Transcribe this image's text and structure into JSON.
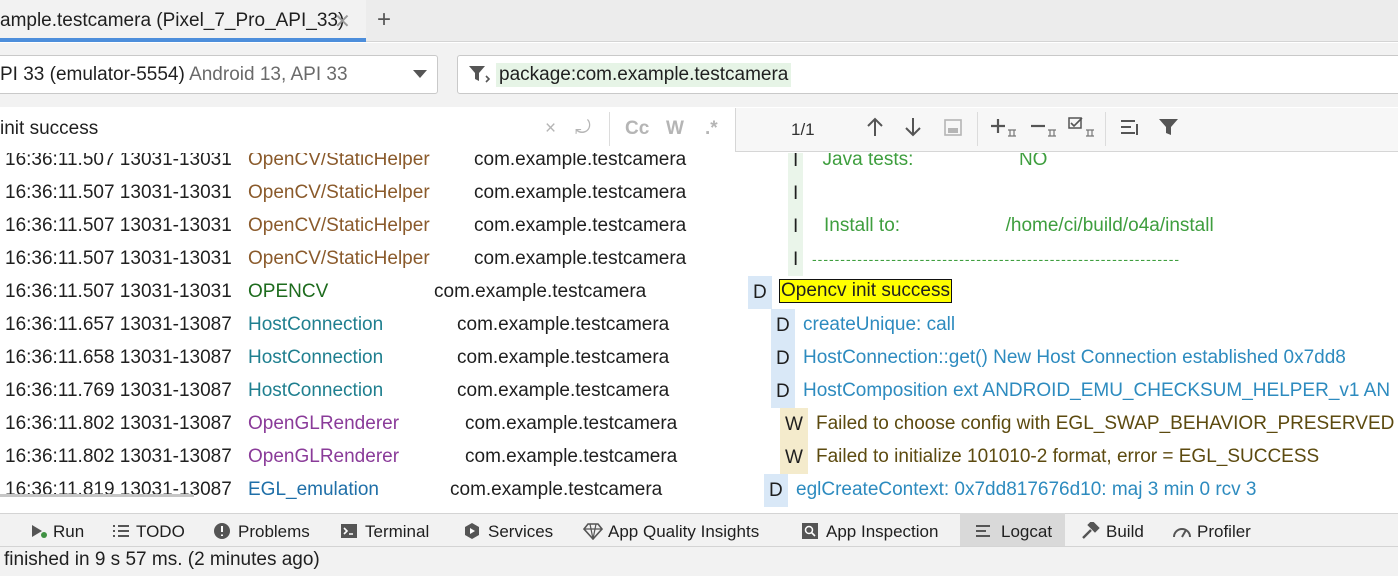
{
  "tab": {
    "title": "ample.testcamera (Pixel_7_Pro_API_33)",
    "close": "✕",
    "add": "+"
  },
  "device": {
    "name": "PI 33 (emulator-5554)",
    "detail": "Android 13, API 33"
  },
  "filter": {
    "query": "package:com.example.testcamera"
  },
  "search": {
    "text": "init success",
    "buttons": {
      "clear": "×",
      "regex_toggle": "⤾",
      "match_case": "Cc",
      "words": "W",
      "regex": ".*"
    },
    "count": "1/1"
  },
  "log_lines": [
    {
      "ts": "16:36:11.507 13031-13031",
      "tag": "OpenCV/StaticHelper",
      "pkg": "com.example.testcamera",
      "level": "I",
      "msg": "  Java tests:                    NO"
    },
    {
      "ts": "16:36:11.507 13031-13031",
      "tag": "OpenCV/StaticHelper",
      "pkg": "com.example.testcamera",
      "level": "I",
      "msg": ""
    },
    {
      "ts": "16:36:11.507 13031-13031",
      "tag": "OpenCV/StaticHelper",
      "pkg": "com.example.testcamera",
      "level": "I",
      "msg": "Install to:                    /home/ci/build/o4a/install"
    },
    {
      "ts": "16:36:11.507 13031-13031",
      "tag": "OpenCV/StaticHelper",
      "pkg": "com.example.testcamera",
      "level": "I",
      "msg": "-----------------------------------------------------------------"
    },
    {
      "ts": "16:36:11.507 13031-13031",
      "tag": "OPENCV",
      "pkg": "com.example.testcamera",
      "level": "D",
      "msg": "Opencv init success"
    },
    {
      "ts": "16:36:11.657 13031-13087",
      "tag": "HostConnection",
      "pkg": "com.example.testcamera",
      "level": "D",
      "msg": "createUnique: call"
    },
    {
      "ts": "16:36:11.658 13031-13087",
      "tag": "HostConnection",
      "pkg": "com.example.testcamera",
      "level": "D",
      "msg": "HostConnection::get() New Host Connection established 0x7dd8"
    },
    {
      "ts": "16:36:11.769 13031-13087",
      "tag": "HostConnection",
      "pkg": "com.example.testcamera",
      "level": "D",
      "msg": "HostComposition ext ANDROID_EMU_CHECKSUM_HELPER_v1 AN"
    },
    {
      "ts": "16:36:11.802 13031-13087",
      "tag": "OpenGLRenderer",
      "pkg": "com.example.testcamera",
      "level": "W",
      "msg": "Failed to choose config with EGL_SWAP_BEHAVIOR_PRESERVED"
    },
    {
      "ts": "16:36:11.802 13031-13087",
      "tag": "OpenGLRenderer",
      "pkg": "com.example.testcamera",
      "level": "W",
      "msg": "Failed to initialize 101010-2 format, error = EGL_SUCCESS"
    },
    {
      "ts": "16:36:11.819 13031-13087",
      "tag": "EGL_emulation",
      "pkg": "com.example.testcamera",
      "level": "D",
      "msg": "eglCreateContext: 0x7dd817676d10: maj 3 min 0 rcv 3"
    }
  ],
  "tool_windows": [
    {
      "label": "Run",
      "icon": "run-icon"
    },
    {
      "label": "TODO",
      "icon": "todo-icon"
    },
    {
      "label": "Problems",
      "icon": "problems-icon"
    },
    {
      "label": "Terminal",
      "icon": "terminal-icon"
    },
    {
      "label": "Services",
      "icon": "services-icon"
    },
    {
      "label": "App Quality Insights",
      "icon": "app-quality-icon"
    },
    {
      "label": "App Inspection",
      "icon": "app-inspection-icon"
    },
    {
      "label": "Logcat",
      "icon": "logcat-icon"
    },
    {
      "label": "Build",
      "icon": "build-icon"
    },
    {
      "label": "Profiler",
      "icon": "profiler-icon"
    }
  ],
  "status": {
    "text": "finished in 9 s 57 ms. (2 minutes ago)"
  },
  "colors": {
    "accent": "#4d8edb",
    "highlight": "#ffff00",
    "info_bg": "#eaf5ea",
    "debug_bg": "#d9e8f7",
    "warn_bg": "#f4ebcc"
  }
}
